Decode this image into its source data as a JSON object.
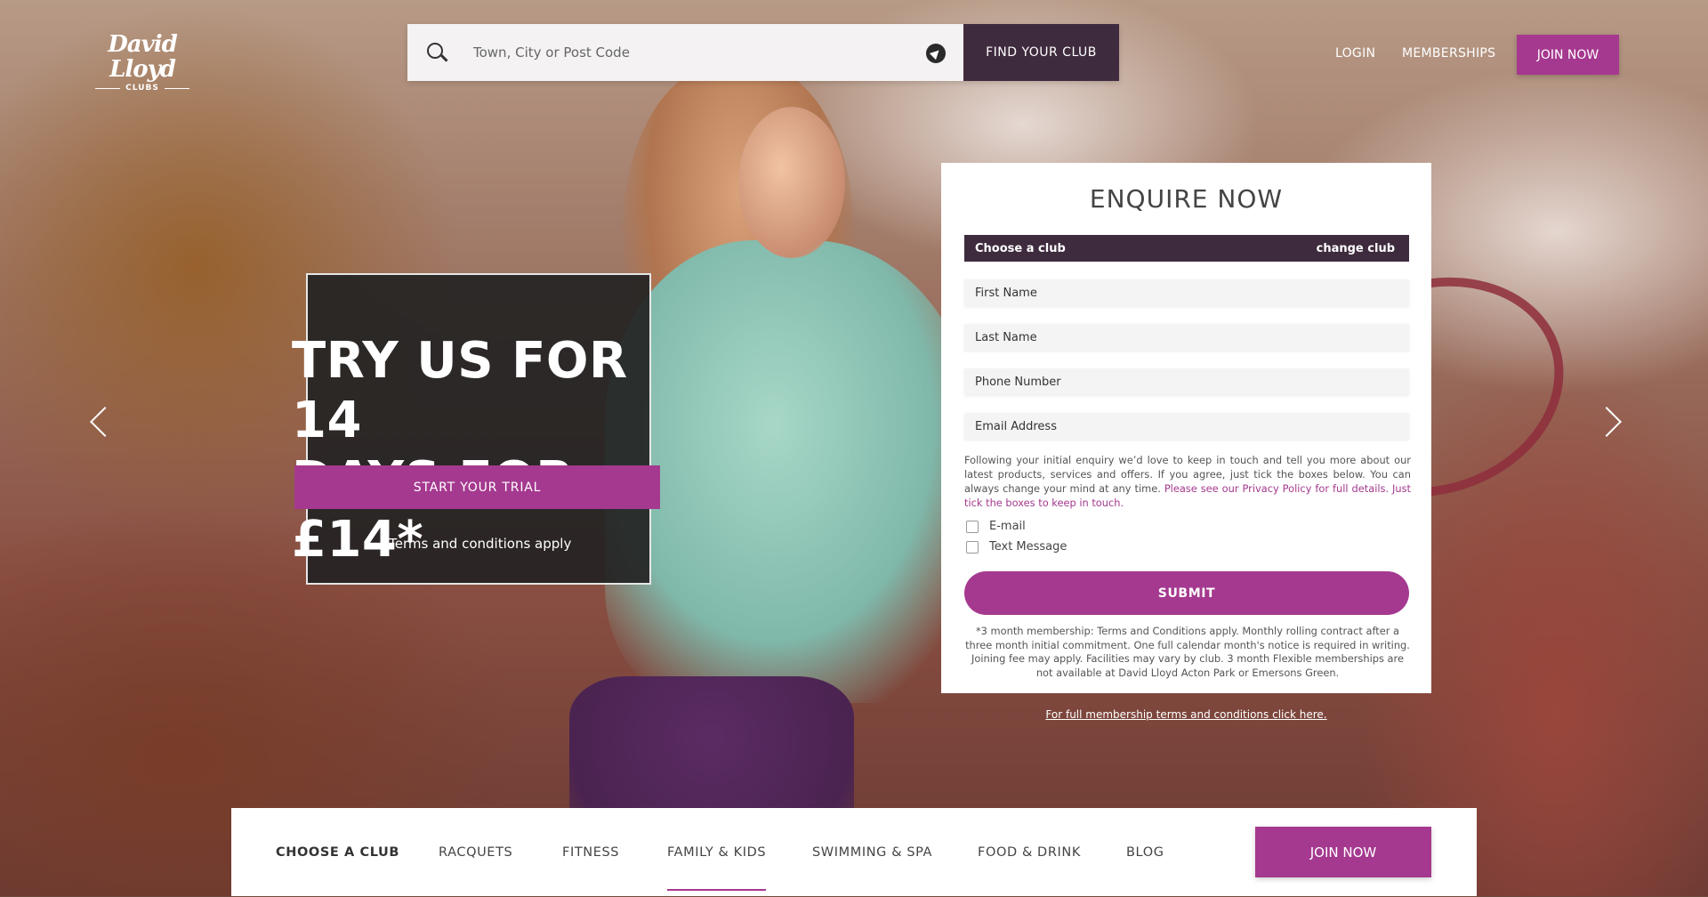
{
  "brand": {
    "logo_main": "David Lloyd",
    "logo_sub": "CLUBS"
  },
  "search": {
    "placeholder": "Town, City or Post Code",
    "button_label": "FIND YOUR CLUB"
  },
  "header": {
    "login": "LOGIN",
    "memberships": "MEMBERSHIPS",
    "join_now": "JOIN NOW"
  },
  "promo": {
    "title_line1": "TRY US FOR 14",
    "title_line2": "DAYS FOR £14*",
    "cta": "START YOUR TRIAL",
    "terms": "*Terms and conditions apply"
  },
  "enquire": {
    "title": "ENQUIRE NOW",
    "club_label": "Choose a club",
    "change_club": "change club",
    "fields": {
      "first_name": "First Name",
      "last_name": "Last Name",
      "phone": "Phone Number",
      "email": "Email Address"
    },
    "consent_text": "Following your initial enquiry we’d love to keep in touch and tell you more about our latest products, services and offers. If you agree, just tick the boxes below. You can always change your mind at any time.",
    "consent_link": "Please see our Privacy Policy for full details. Just tick the boxes to keep in touch.",
    "checkboxes": {
      "email": "E-mail",
      "text": "Text Message"
    },
    "submit": "SUBMIT",
    "disclaimer": "*3 month membership: Terms and Conditions apply. Monthly rolling contract after a three month initial commitment. One full calendar month's notice is required in writing. Joining fee may apply. Facilities may vary by club. 3 month Flexible memberships are not available at David Lloyd Acton Park or Emersons Green.",
    "full_terms_link": "For full membership terms and conditions click here."
  },
  "bottom_nav": {
    "items": [
      "CHOOSE A CLUB",
      "RACQUETS",
      "FITNESS",
      "FAMILY & KIDS",
      "SWIMMING & SPA",
      "FOOD & DRINK",
      "BLOG"
    ],
    "join_now": "JOIN NOW"
  },
  "colors": {
    "accent": "#a5398f",
    "dark": "#3f2b3e"
  }
}
